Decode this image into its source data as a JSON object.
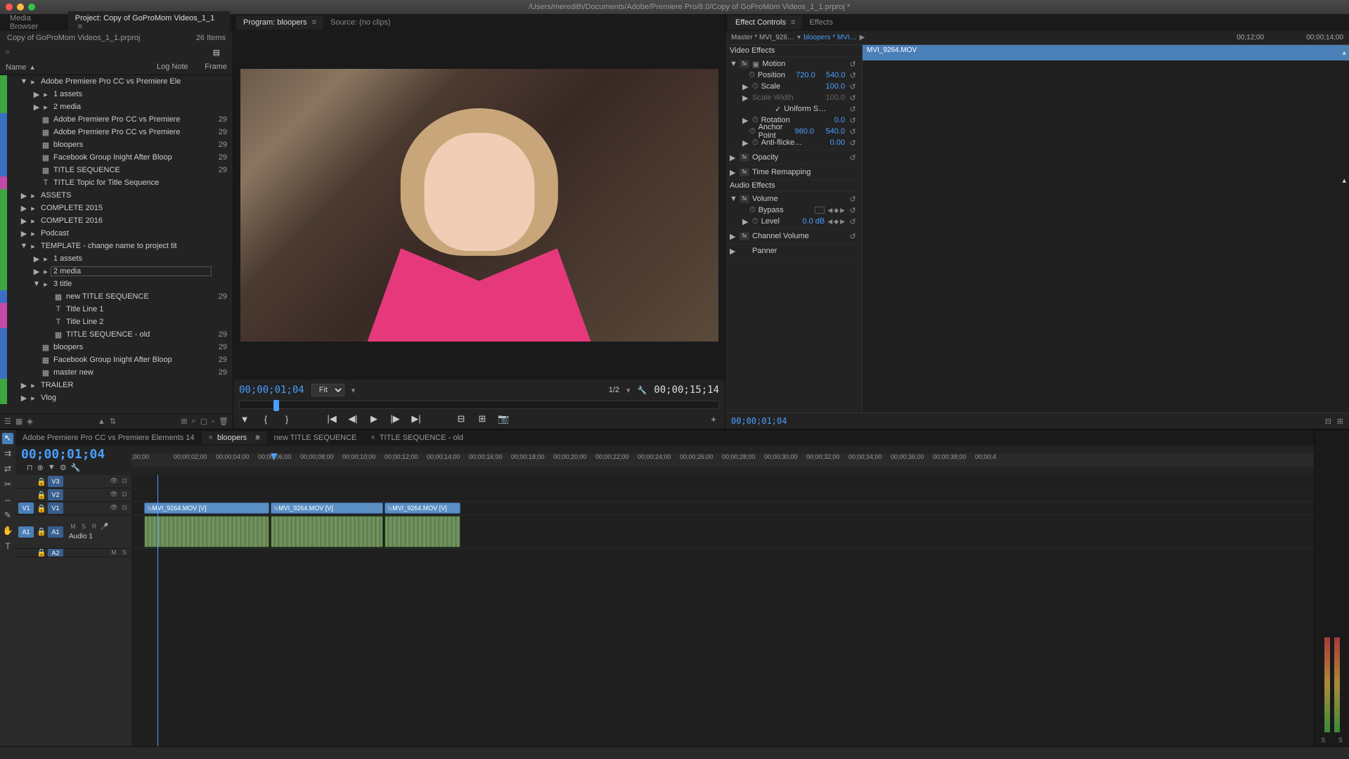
{
  "window": {
    "title": "/Users/meredith/Documents/Adobe/Premiere Pro/8.0/Copy of GoProMom Videos_1_1.prproj *"
  },
  "project": {
    "mediaBrowserTab": "Media Browser",
    "projectTab": "Project: Copy of GoProMom Videos_1_1",
    "filename": "Copy of GoProMom Videos_1_1.prproj",
    "itemCount": "26 Items",
    "cols": {
      "name": "Name",
      "lognote": "Log Note",
      "frame": "Frame"
    },
    "tree": [
      {
        "color": "ct-green",
        "indent": 1,
        "twisty": "▼",
        "icon": "folder",
        "label": "Adobe Premiere Pro CC vs Premiere Ele",
        "rate": ""
      },
      {
        "color": "ct-green",
        "indent": 2,
        "twisty": "▶",
        "icon": "folder",
        "label": "1 assets",
        "rate": ""
      },
      {
        "color": "ct-green",
        "indent": 2,
        "twisty": "▶",
        "icon": "folder",
        "label": "2 media",
        "rate": ""
      },
      {
        "color": "ct-blue",
        "indent": 2,
        "twisty": "",
        "icon": "seq",
        "label": "Adobe Premiere Pro CC vs Premiere",
        "rate": "29"
      },
      {
        "color": "ct-blue",
        "indent": 2,
        "twisty": "",
        "icon": "seq",
        "label": "Adobe Premiere Pro CC vs Premiere",
        "rate": "29"
      },
      {
        "color": "ct-blue",
        "indent": 2,
        "twisty": "",
        "icon": "seq",
        "label": "bloopers",
        "rate": "29"
      },
      {
        "color": "ct-blue",
        "indent": 2,
        "twisty": "",
        "icon": "seq",
        "label": "Facebook Group Inight After Bloop",
        "rate": "29"
      },
      {
        "color": "ct-blue",
        "indent": 2,
        "twisty": "",
        "icon": "seq",
        "label": "TITLE SEQUENCE",
        "rate": "29"
      },
      {
        "color": "ct-magenta",
        "indent": 2,
        "twisty": "",
        "icon": "title",
        "label": "TITLE Topic for Title Sequence",
        "rate": ""
      },
      {
        "color": "ct-green",
        "indent": 1,
        "twisty": "▶",
        "icon": "folder",
        "label": "ASSETS",
        "rate": ""
      },
      {
        "color": "ct-green",
        "indent": 1,
        "twisty": "▶",
        "icon": "folder",
        "label": "COMPLETE 2015",
        "rate": ""
      },
      {
        "color": "ct-green",
        "indent": 1,
        "twisty": "▶",
        "icon": "folder",
        "label": "COMPLETE 2016",
        "rate": ""
      },
      {
        "color": "ct-green",
        "indent": 1,
        "twisty": "▶",
        "icon": "folder",
        "label": "Podcast",
        "rate": ""
      },
      {
        "color": "ct-green",
        "indent": 1,
        "twisty": "▼",
        "icon": "folder",
        "label": "TEMPLATE - change name to project tit",
        "rate": ""
      },
      {
        "color": "ct-green",
        "indent": 2,
        "twisty": "▶",
        "icon": "folder",
        "label": "1 assets",
        "rate": ""
      },
      {
        "color": "ct-green",
        "indent": 2,
        "twisty": "▶",
        "icon": "folder",
        "label": "2 media",
        "rate": "",
        "selected": true
      },
      {
        "color": "ct-green",
        "indent": 2,
        "twisty": "▼",
        "icon": "folder",
        "label": "3 title",
        "rate": ""
      },
      {
        "color": "ct-blue",
        "indent": 3,
        "twisty": "",
        "icon": "seq",
        "label": "new TITLE SEQUENCE",
        "rate": "29"
      },
      {
        "color": "ct-magenta",
        "indent": 3,
        "twisty": "",
        "icon": "title",
        "label": "Title Line 1",
        "rate": ""
      },
      {
        "color": "ct-magenta",
        "indent": 3,
        "twisty": "",
        "icon": "title",
        "label": "Title Line 2",
        "rate": ""
      },
      {
        "color": "ct-blue",
        "indent": 3,
        "twisty": "",
        "icon": "seq",
        "label": "TITLE SEQUENCE - old",
        "rate": "29"
      },
      {
        "color": "ct-blue",
        "indent": 2,
        "twisty": "",
        "icon": "seq",
        "label": "bloopers",
        "rate": "29"
      },
      {
        "color": "ct-blue",
        "indent": 2,
        "twisty": "",
        "icon": "seq",
        "label": "Facebook Group Inight After Bloop",
        "rate": "29"
      },
      {
        "color": "ct-blue",
        "indent": 2,
        "twisty": "",
        "icon": "seq",
        "label": "master new",
        "rate": "29"
      },
      {
        "color": "ct-green",
        "indent": 1,
        "twisty": "▶",
        "icon": "folder",
        "label": "TRAILER",
        "rate": ""
      },
      {
        "color": "ct-green",
        "indent": 1,
        "twisty": "▶",
        "icon": "folder",
        "label": "Vlog",
        "rate": ""
      }
    ]
  },
  "program": {
    "tabLabel": "Program: bloopers",
    "sourceTab": "Source: (no clips)",
    "tcLeft": "00;00;01;04",
    "fit": "Fit",
    "resolution": "1/2",
    "tcRight": "00;00;15;14"
  },
  "effects": {
    "tabLabel": "Effect Controls",
    "effectsTab": "Effects",
    "master": "Master * MVI_926…",
    "clipLink": "bloopers * MVI…",
    "tc1": "00;12;00",
    "tc2": "00;00;14;00",
    "clipSpan": "MVI_9264.MOV",
    "videoEffects": "Video Effects",
    "motion": {
      "label": "Motion",
      "position": {
        "label": "Position",
        "x": "720.0",
        "y": "540.0"
      },
      "scale": {
        "label": "Scale",
        "val": "100.0"
      },
      "scaleWidth": {
        "label": "Scale Width",
        "val": "100.0"
      },
      "uniform": {
        "label": "Uniform S…"
      },
      "rotation": {
        "label": "Rotation",
        "val": "0.0"
      },
      "anchor": {
        "label": "Anchor Point",
        "x": "960.0",
        "y": "540.0"
      },
      "antiflicker": {
        "label": "Anti-flicke…",
        "val": "0.00"
      }
    },
    "opacity": "Opacity",
    "timeRemap": "Time Remapping",
    "audioEffects": "Audio Effects",
    "volume": {
      "label": "Volume",
      "bypass": "Bypass",
      "level": {
        "label": "Level",
        "val": "0.0 dB"
      }
    },
    "channelVol": "Channel Volume",
    "panner": "Panner",
    "footerTc": "00;00;01;04"
  },
  "timeline": {
    "tabs": [
      {
        "label": "Adobe Premiere Pro CC vs Premiere Elements 14",
        "close": false
      },
      {
        "label": "bloopers",
        "close": true,
        "active": true
      },
      {
        "label": "new TITLE SEQUENCE",
        "close": false
      },
      {
        "label": "TITLE SEQUENCE - old",
        "close": true
      }
    ],
    "tc": "00;00;01;04",
    "ruler": [
      ";00;00",
      "00;00;02;00",
      "00;00;04;00",
      "00;00;06;00",
      "00;00;08;00",
      "00;00;10;00",
      "00;00;12;00",
      "00;00;14;00",
      "00;00;16;00",
      "00;00;18;00",
      "00;00;20;00",
      "00;00;22;00",
      "00;00;24;00",
      "00;00;26;00",
      "00;00;28;00",
      "00;00;30;00",
      "00;00;32;00",
      "00;00;34;00",
      "00;00;36;00",
      "00;00;38;00",
      "00;00;4"
    ],
    "tracks": {
      "v3": "V3",
      "v2": "V2",
      "v1src": "V1",
      "v1": "V1",
      "a1src": "A1",
      "a1": "A1",
      "audio1": "Audio 1",
      "a2": "A2"
    },
    "clips": {
      "v1a": "MVI_9264.MOV [V]",
      "v1b": "MVI_9264.MOV [V]",
      "v1c": "MVI_9264.MOV [V]"
    },
    "mixBtns": {
      "m": "M",
      "s": "S",
      "r": "R"
    },
    "meterLabels": {
      "s1": "S",
      "s2": "S"
    }
  }
}
